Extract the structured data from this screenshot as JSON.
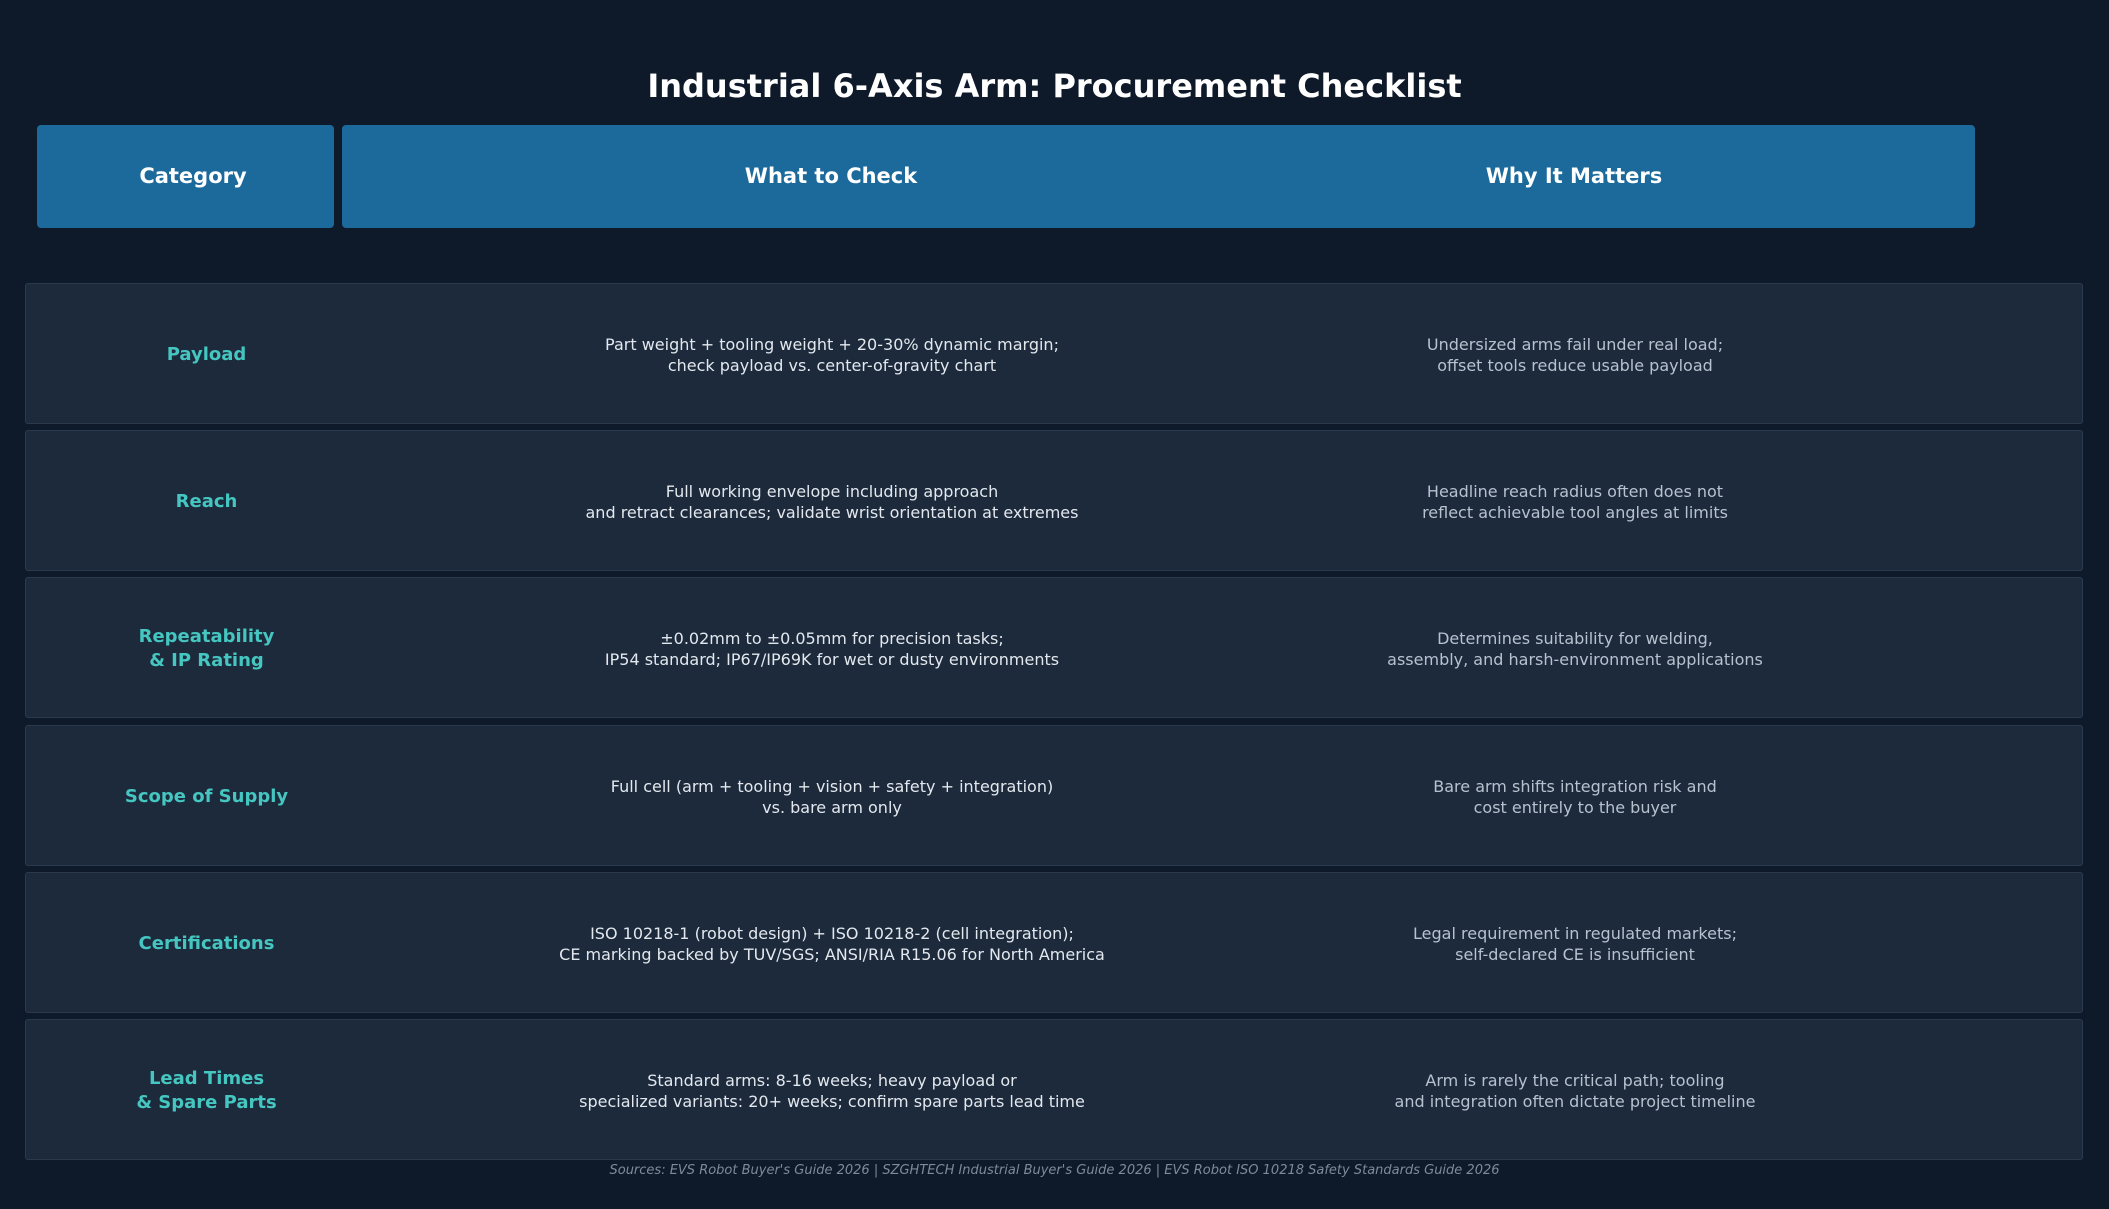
{
  "title": "Industrial 6-Axis Arm: Procurement Checklist",
  "headers": {
    "category": "Category",
    "what_to_check": "What to Check",
    "why_it_matters": "Why It Matters"
  },
  "rows": [
    {
      "category": "Payload",
      "check": "Part weight + tooling weight + 20-30% dynamic margin;\ncheck payload vs. center-of-gravity chart",
      "why": "Undersized arms fail under real load;\noffset tools reduce usable payload"
    },
    {
      "category": "Reach",
      "check": "Full working envelope including approach\nand retract clearances; validate wrist orientation at extremes",
      "why": "Headline reach radius often does not\nreflect achievable tool angles at limits"
    },
    {
      "category": "Repeatability\n& IP Rating",
      "check": "±0.02mm to ±0.05mm for precision tasks;\nIP54 standard; IP67/IP69K for wet or dusty environments",
      "why": "Determines suitability for welding,\nassembly, and harsh-environment applications"
    },
    {
      "category": "Scope of Supply",
      "check": "Full cell (arm + tooling + vision + safety + integration)\nvs. bare arm only",
      "why": "Bare arm shifts integration risk and\ncost entirely to the buyer"
    },
    {
      "category": "Certifications",
      "check": "ISO 10218-1 (robot design) + ISO 10218-2 (cell integration);\nCE marking backed by TUV/SGS; ANSI/RIA R15.06 for North America",
      "why": "Legal requirement in regulated markets;\nself-declared CE is insufficient"
    },
    {
      "category": "Lead Times\n& Spare Parts",
      "check": "Standard arms: 8-16 weeks; heavy payload or\nspecialized variants: 20+ weeks; confirm spare parts lead time",
      "why": "Arm is rarely the critical path; tooling\nand integration often dictate project timeline"
    }
  ],
  "sources": "Sources: EVS Robot Buyer's Guide 2026 | SZGHTECH Industrial Buyer's Guide 2026 | EVS Robot ISO 10218 Safety Standards Guide 2026",
  "colors": {
    "background": "#0e1a2a",
    "header": "#1b6a9b",
    "row": "#1c2a3c",
    "category_accent": "#45c6c0"
  }
}
